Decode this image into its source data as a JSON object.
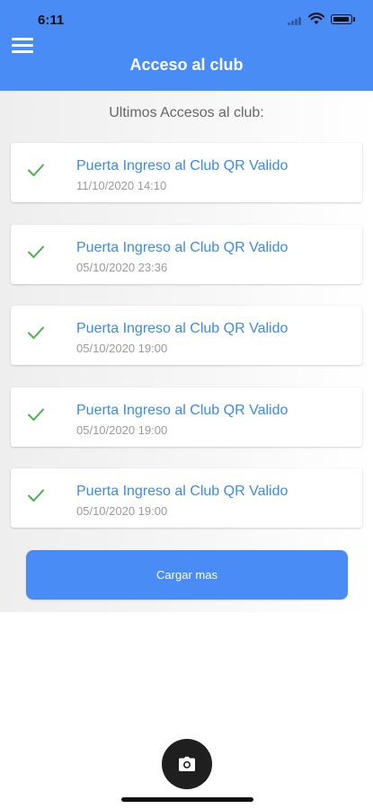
{
  "status_bar": {
    "time": "6:11"
  },
  "header": {
    "title": "Acceso al club",
    "menu_icon": "hamburger-menu-icon"
  },
  "section": {
    "heading": "Ultimos Accesos al club:"
  },
  "access_list": [
    {
      "title": "Puerta Ingreso al Club QR Valido",
      "date": "11/10/2020 14:10"
    },
    {
      "title": "Puerta Ingreso al Club QR Valido",
      "date": "05/10/2020 23:36"
    },
    {
      "title": "Puerta Ingreso al Club QR Valido",
      "date": "05/10/2020 19:00"
    },
    {
      "title": "Puerta Ingreso al Club QR Valido",
      "date": "05/10/2020 19:00"
    },
    {
      "title": "Puerta Ingreso al Club QR Valido",
      "date": "05/10/2020 19:00"
    }
  ],
  "load_more": {
    "label": "Cargar mas"
  },
  "fab": {
    "icon": "camera-icon"
  },
  "colors": {
    "primary": "#4a8cf6",
    "link": "#3b8ddf",
    "success": "#4caf50",
    "date": "#9a9a9a"
  }
}
